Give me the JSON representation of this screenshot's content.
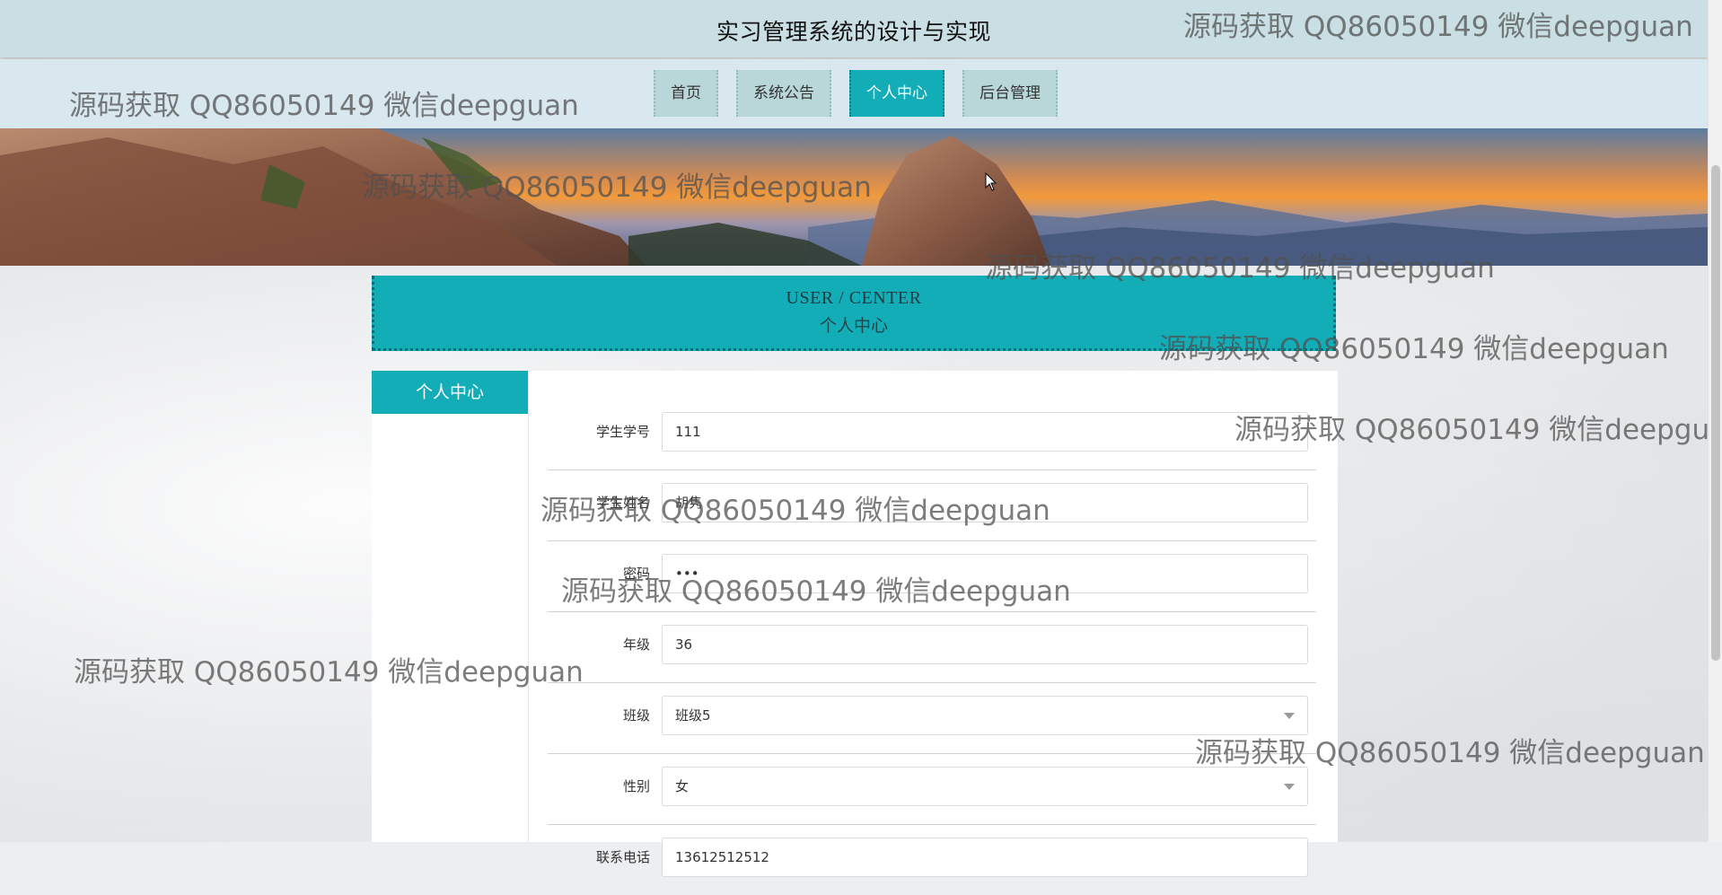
{
  "header": {
    "title": "实习管理系统的设计与实现"
  },
  "nav": {
    "items": [
      {
        "label": "首页"
      },
      {
        "label": "系统公告"
      },
      {
        "label": "个人中心"
      },
      {
        "label": "后台管理"
      }
    ]
  },
  "user_center": {
    "title_en": "USER / CENTER",
    "title_cn": "个人中心"
  },
  "sidebar": {
    "title": "个人中心"
  },
  "form": {
    "student_id": {
      "label": "学生学号",
      "value": "111"
    },
    "student_name": {
      "label": "学生姓名",
      "value": "胡隽"
    },
    "password": {
      "label": "密码",
      "value": "•••"
    },
    "grade": {
      "label": "年级",
      "value": "36"
    },
    "class": {
      "label": "班级",
      "value": "班级5"
    },
    "gender": {
      "label": "性别",
      "value": "女"
    },
    "phone": {
      "label": "联系电话",
      "value": "13612512512"
    }
  },
  "watermark": {
    "text": "源码获取 QQ86050149 微信deepguan"
  },
  "colors": {
    "accent": "#13adb8",
    "topbar": "#c9dfe3",
    "navbar": "#d9e7ee"
  }
}
